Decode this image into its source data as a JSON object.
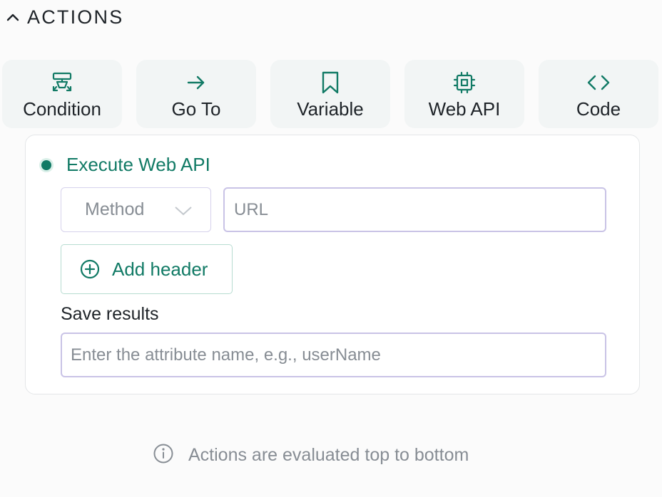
{
  "section": {
    "title": "ACTIONS",
    "toggle_icon": "chevron-up-icon"
  },
  "action_tiles": [
    {
      "label": "Condition",
      "icon": "condition-icon"
    },
    {
      "label": "Go To",
      "icon": "arrow-right-icon"
    },
    {
      "label": "Variable",
      "icon": "bookmark-icon"
    },
    {
      "label": "Web API",
      "icon": "chip-icon"
    },
    {
      "label": "Code",
      "icon": "code-brackets-icon"
    }
  ],
  "web_api_card": {
    "title": "Execute Web API",
    "method": {
      "placeholder": "Method",
      "icon": "chevron-down-icon"
    },
    "url": {
      "placeholder": "URL",
      "value": ""
    },
    "add_header": {
      "label": "Add header",
      "icon": "plus-circle-icon"
    },
    "save_results": {
      "label": "Save results",
      "placeholder": "Enter the attribute name, e.g., userName",
      "value": ""
    }
  },
  "footer": {
    "note": "Actions are evaluated top to bottom",
    "icon": "info-icon"
  },
  "colors": {
    "accent": "#117a65",
    "tile_background": "#f2f5f5",
    "input_border": "#c9c3e6",
    "muted_text": "#878d94"
  }
}
